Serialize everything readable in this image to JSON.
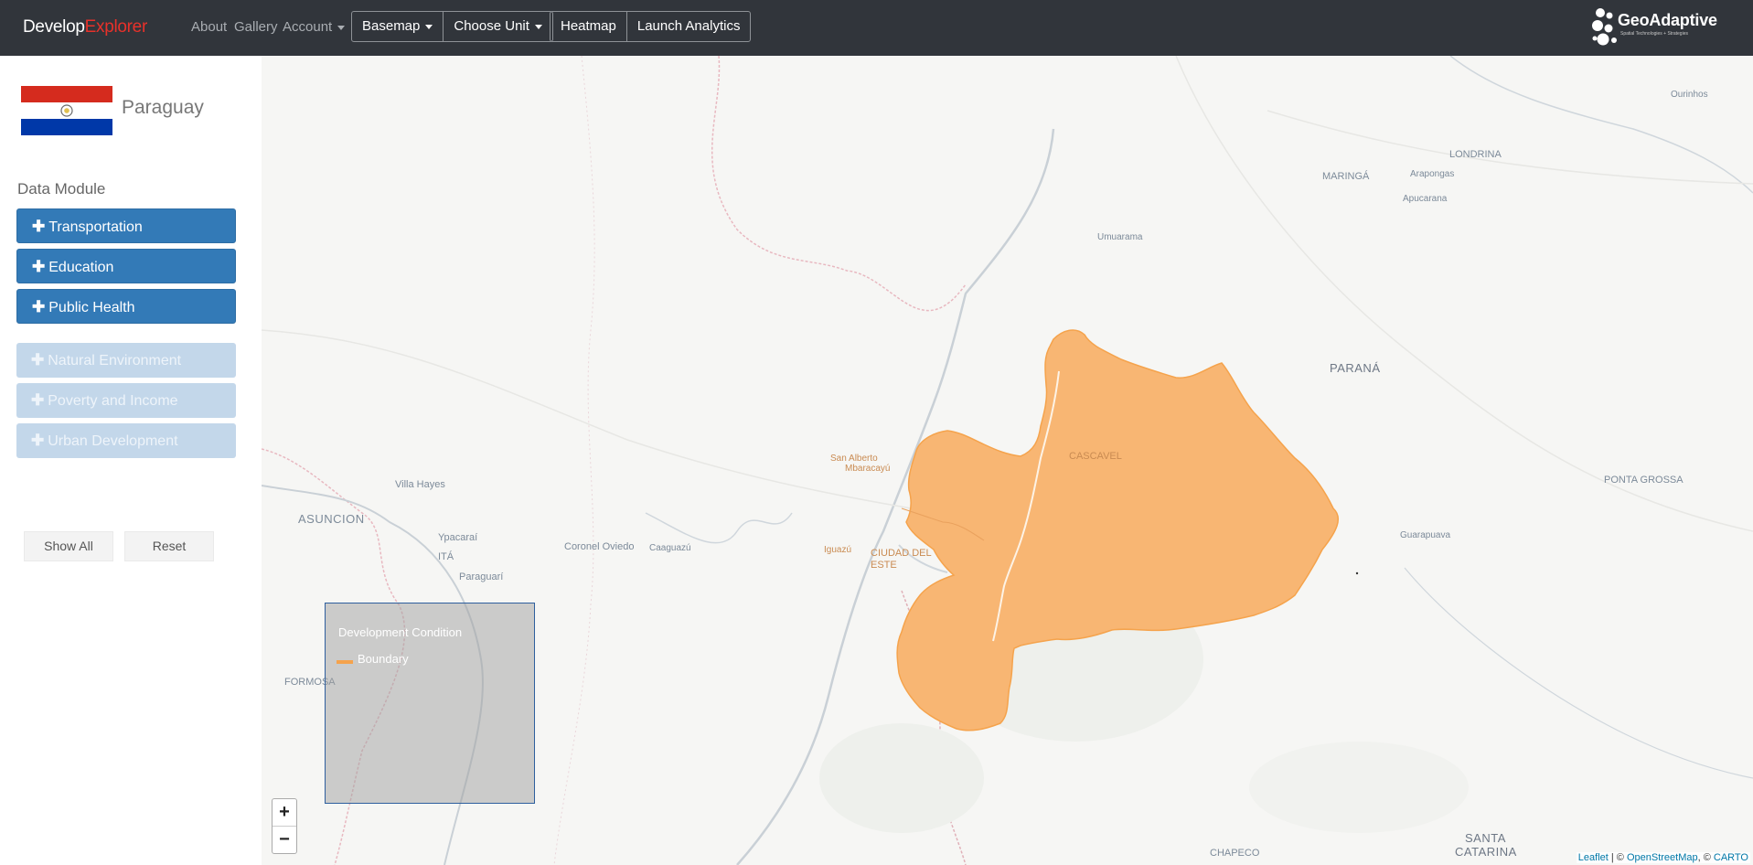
{
  "navbar": {
    "brand_primary": "Develop",
    "brand_accent": "Explorer",
    "about": "About",
    "gallery": "Gallery",
    "account": "Account",
    "basemap": "Basemap",
    "choose_unit": "Choose Unit",
    "heatmap": "Heatmap",
    "launch_analytics": "Launch Analytics",
    "logo_text": "GeoAdaptive",
    "logo_subtitle": "Spatial Technologies + Strategies"
  },
  "sidebar": {
    "country": "Paraguay",
    "data_module_title": "Data Module",
    "modules": [
      {
        "label": "Transportation",
        "active": true
      },
      {
        "label": "Education",
        "active": true
      },
      {
        "label": "Public Health",
        "active": true
      },
      {
        "label": "Natural Environment",
        "active": false
      },
      {
        "label": "Poverty and Income",
        "active": false
      },
      {
        "label": "Urban Development",
        "active": false
      }
    ],
    "show_all": "Show All",
    "reset": "Reset"
  },
  "map": {
    "labels": {
      "asuncion": "ASUNCION",
      "villa_hayes": "Villa Hayes",
      "ypacarai": "Ypacaraí",
      "ita": "ITÁ",
      "paraguari": "Paraguarí",
      "coronel_oviedo": "Coronel Oviedo",
      "caaguazu": "Caaguazú",
      "formosa": "FORMOSA",
      "san_alberto": "San Alberto",
      "mbaracayu": "Mbaracayú",
      "cascavel": "CASCAVEL",
      "ciudad_del_este": "CIUDAD DEL ESTE",
      "iguazu": "Iguazú",
      "umuarama": "Umuarama",
      "maringa": "MARINGÁ",
      "arapongas": "Arapongas",
      "apucarana": "Apucarana",
      "londrina": "LONDRINA",
      "ourinhos": "Ourinhos",
      "parana": "PARANÁ",
      "ponta_grossa": "PONTA GROSSA",
      "guarapuava": "Guarapuava",
      "chapeco": "CHAPECO",
      "santa_catarina_1": "SANTA",
      "santa_catarina_2": "CATARINA"
    },
    "boundary_color": "#f5a34c"
  },
  "legend": {
    "title": "Development Condition",
    "item": "Boundary"
  },
  "zoom": {
    "in": "+",
    "out": "−"
  },
  "attribution": {
    "leaflet": "Leaflet",
    "sep1": " | © ",
    "osm": "OpenStreetMap",
    "sep2": ", © ",
    "carto": "CARTO"
  },
  "colors": {
    "navbar": "#31353b",
    "brand_accent": "#e8312a",
    "module_active": "#337ab7",
    "module_inactive": "#c3d7ea"
  }
}
